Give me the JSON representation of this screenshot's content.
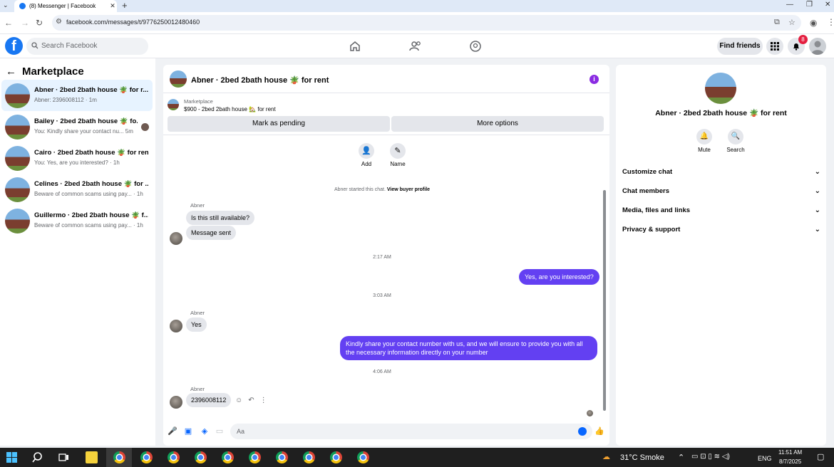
{
  "browser": {
    "tab_title": "(8) Messenger | Facebook",
    "url": "facebook.com/messages/t/9776250012480460"
  },
  "header": {
    "search_placeholder": "Search Facebook",
    "find_friends": "Find friends",
    "notification_count": "8"
  },
  "sidebar": {
    "title": "Marketplace",
    "conversations": [
      {
        "name": "Abner · 2bed 2bath house 🪴 for r...",
        "preview": "Abner: 2396008112 · 1m",
        "active": true
      },
      {
        "name": "Bailey · 2bed 2bath house 🪴 fo...",
        "preview": "You: Kindly share your contact nu...   5m",
        "active": false
      },
      {
        "name": "Cairo · 2bed 2bath house 🪴 for rent",
        "preview": "You: Yes, are you interested? · 1h",
        "active": false
      },
      {
        "name": "Celines · 2bed 2bath house 🪴 for ...",
        "preview": "Beware of common scams using pay...   · 1h",
        "active": false
      },
      {
        "name": "Guillermo · 2bed 2bath house 🪴 f...",
        "preview": "Beware of common scams using pay...   · 1h",
        "active": false
      }
    ]
  },
  "chat": {
    "title": "Abner · 2bed 2bath house 🪴 for rent",
    "marketplace_label": "Marketplace",
    "listing": "$900 - 2bed 2bath house 🏡 for rent",
    "mark_pending": "Mark as pending",
    "more_options": "More options",
    "add_label": "Add",
    "name_label": "Name",
    "started_note": "Abner started this chat.",
    "view_profile": "View buyer profile",
    "sender": "Abner",
    "msg_available": "Is this still available?",
    "msg_sent": "Message sent",
    "time1": "2:17 AM",
    "out1": "Yes, are you interested?",
    "time2": "3:03 AM",
    "msg_yes": "Yes",
    "out2": "Kindly share your contact number with us, and we will ensure to provide you with all the necessary information directly on your number",
    "time3": "4:06 AM",
    "msg_number": "2396008112",
    "composer_placeholder": "Aa"
  },
  "details": {
    "title": "Abner · 2bed 2bath house 🪴 for rent",
    "mute": "Mute",
    "search": "Search",
    "sections": [
      "Customize chat",
      "Chat members",
      "Media, files and links",
      "Privacy & support"
    ]
  },
  "taskbar": {
    "weather": "31°C  Smoke",
    "lang": "ENG",
    "time": "11:51 AM",
    "date": "8/7/2025"
  },
  "colors": {
    "fb_blue": "#1877f2",
    "bubble_out": "#6340f2",
    "active_row": "#e7f3ff"
  }
}
